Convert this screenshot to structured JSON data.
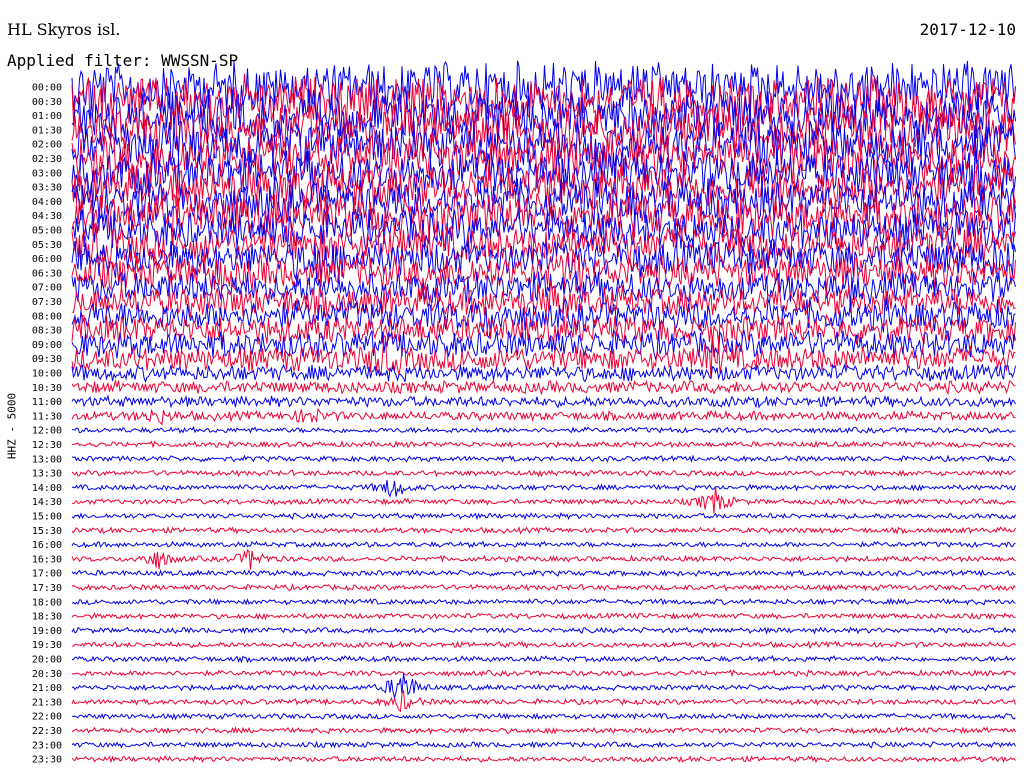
{
  "header": {
    "station": "HL Skyros isl.",
    "date": "2017-12-10",
    "filter": "Applied filter: WWSSN-SP",
    "channel": "HHZ - 5000"
  },
  "colors": {
    "trace_a": "#0000ee",
    "trace_b": "#ee0033"
  },
  "chart_data": {
    "type": "line",
    "title": "HL Skyros isl.",
    "subtitle": "Applied filter: WWSSN-SP",
    "ylabel": "HHZ - 5000",
    "time_labels": [
      "00:00",
      "00:30",
      "01:00",
      "01:30",
      "02:00",
      "02:30",
      "03:00",
      "03:30",
      "04:00",
      "04:30",
      "05:00",
      "05:30",
      "06:00",
      "06:30",
      "07:00",
      "07:30",
      "08:00",
      "08:30",
      "09:00",
      "09:30",
      "10:00",
      "10:30",
      "11:00",
      "11:30",
      "12:00",
      "12:30",
      "13:00",
      "13:30",
      "14:00",
      "14:30",
      "15:00",
      "15:30",
      "16:00",
      "16:30",
      "17:00",
      "17:30",
      "18:00",
      "18:30",
      "19:00",
      "19:30",
      "20:00",
      "20:30",
      "21:00",
      "21:30",
      "22:00",
      "22:30",
      "23:00",
      "23:30"
    ],
    "trace_colors_alternate": [
      "#0000ee",
      "#ee0033"
    ],
    "noise_level": [
      28,
      28,
      27,
      27,
      26,
      26,
      25,
      25,
      24,
      24,
      22,
      21,
      20,
      19,
      18,
      17,
      17,
      16,
      15,
      14,
      9,
      7,
      6,
      5,
      3,
      3,
      3,
      3,
      3,
      3,
      3,
      3,
      3,
      3,
      3,
      3,
      3,
      3,
      3,
      3,
      3,
      3,
      3,
      3,
      3,
      3,
      3,
      3
    ],
    "events": [
      {
        "line": 11,
        "x": 0.03,
        "amp": 10
      },
      {
        "line": 12,
        "x": 0.26,
        "amp": 12
      },
      {
        "line": 12,
        "x": 0.98,
        "amp": 8
      },
      {
        "line": 13,
        "x": 0.15,
        "amp": 10
      },
      {
        "line": 13,
        "x": 0.53,
        "amp": 16
      },
      {
        "line": 15,
        "x": 0.51,
        "amp": 11
      },
      {
        "line": 16,
        "x": 0.44,
        "amp": 12
      },
      {
        "line": 19,
        "x": 0.33,
        "amp": 15
      },
      {
        "line": 19,
        "x": 0.68,
        "amp": 14
      },
      {
        "line": 23,
        "x": 0.09,
        "amp": 8
      },
      {
        "line": 23,
        "x": 0.25,
        "amp": 8
      },
      {
        "line": 28,
        "x": 0.34,
        "amp": 12
      },
      {
        "line": 29,
        "x": 0.68,
        "amp": 16
      },
      {
        "line": 33,
        "x": 0.09,
        "amp": 11
      },
      {
        "line": 33,
        "x": 0.19,
        "amp": 11
      },
      {
        "line": 42,
        "x": 0.35,
        "amp": 22
      },
      {
        "line": 43,
        "x": 0.35,
        "amp": 10
      }
    ],
    "grid": false,
    "legend": "none"
  }
}
